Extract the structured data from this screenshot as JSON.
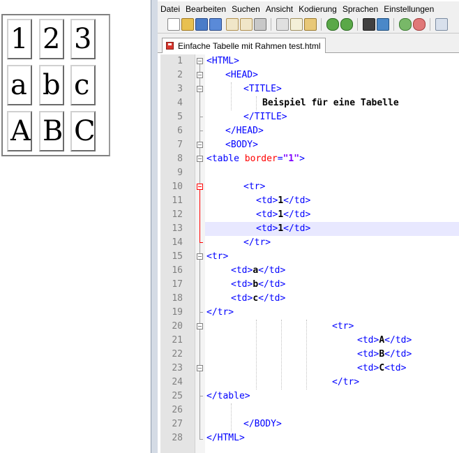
{
  "preview": {
    "rows": [
      [
        "1",
        "2",
        "3"
      ],
      [
        "a",
        "b",
        "c"
      ],
      [
        "A",
        "B",
        "C"
      ]
    ]
  },
  "menu": [
    "Datei",
    "Bearbeiten",
    "Suchen",
    "Ansicht",
    "Kodierung",
    "Sprachen",
    "Einstellungen"
  ],
  "tab": {
    "title": "Einfache Tabelle mit Rahmen test.html"
  },
  "line_numbers": [
    "1",
    "2",
    "3",
    "4",
    "5",
    "6",
    "7",
    "8",
    "9",
    "10",
    "11",
    "12",
    "13",
    "14",
    "15",
    "16",
    "17",
    "18",
    "19",
    "20",
    "21",
    "22",
    "23",
    "24",
    "25",
    "26",
    "27",
    "28"
  ],
  "code": {
    "l1": "<HTML>",
    "l2": "<HEAD>",
    "l3": "<TITLE>",
    "l4": "Beispiel für eine Tabelle",
    "l5": "</TITLE>",
    "l6": "</HEAD>",
    "l7": "<BODY>",
    "l8_open": "<table ",
    "l8_attr": "border",
    "l8_eq": "=",
    "l8_val": "\"1\"",
    "l8_close": ">",
    "l10": "<tr>",
    "l11_a": "<td>",
    "l11_b": "1",
    "l11_c": "</td>",
    "l12_a": "<td>",
    "l12_b": "1",
    "l12_c": "</td>",
    "l13_a": "<td>",
    "l13_b": "1",
    "l13_c": "</td>",
    "l14": "</tr>",
    "l15": "<tr>",
    "l16_a": "<td>",
    "l16_b": "a",
    "l16_c": "</td>",
    "l17_a": "<td>",
    "l17_b": "b",
    "l17_c": "</td>",
    "l18_a": "<td>",
    "l18_b": "c",
    "l18_c": "</td>",
    "l19": "</tr>",
    "l20": "<tr>",
    "l21_a": "<td>",
    "l21_b": "A",
    "l21_c": "</td>",
    "l22_a": "<td>",
    "l22_b": "B",
    "l22_c": "</td>",
    "l23_a": "<td>",
    "l23_b": "C",
    "l23_c": "<td>",
    "l24": "</tr>",
    "l25": "</table>",
    "l27": "</BODY>",
    "l28": "</HTML>"
  },
  "colors": {
    "tag": "#0000ff",
    "attribute": "#ff0000",
    "value": "#8000ff",
    "current_line": "#e8e8ff"
  },
  "toolbar_icons": [
    "new-file-icon",
    "open-file-icon",
    "save-icon",
    "save-all-icon",
    "close-icon",
    "close-all-icon",
    "print-icon",
    "cut-icon",
    "copy-icon",
    "paste-icon",
    "undo-icon",
    "redo-icon",
    "find-icon",
    "replace-icon",
    "zoom-in-icon",
    "zoom-out-icon",
    "sync-icon"
  ]
}
